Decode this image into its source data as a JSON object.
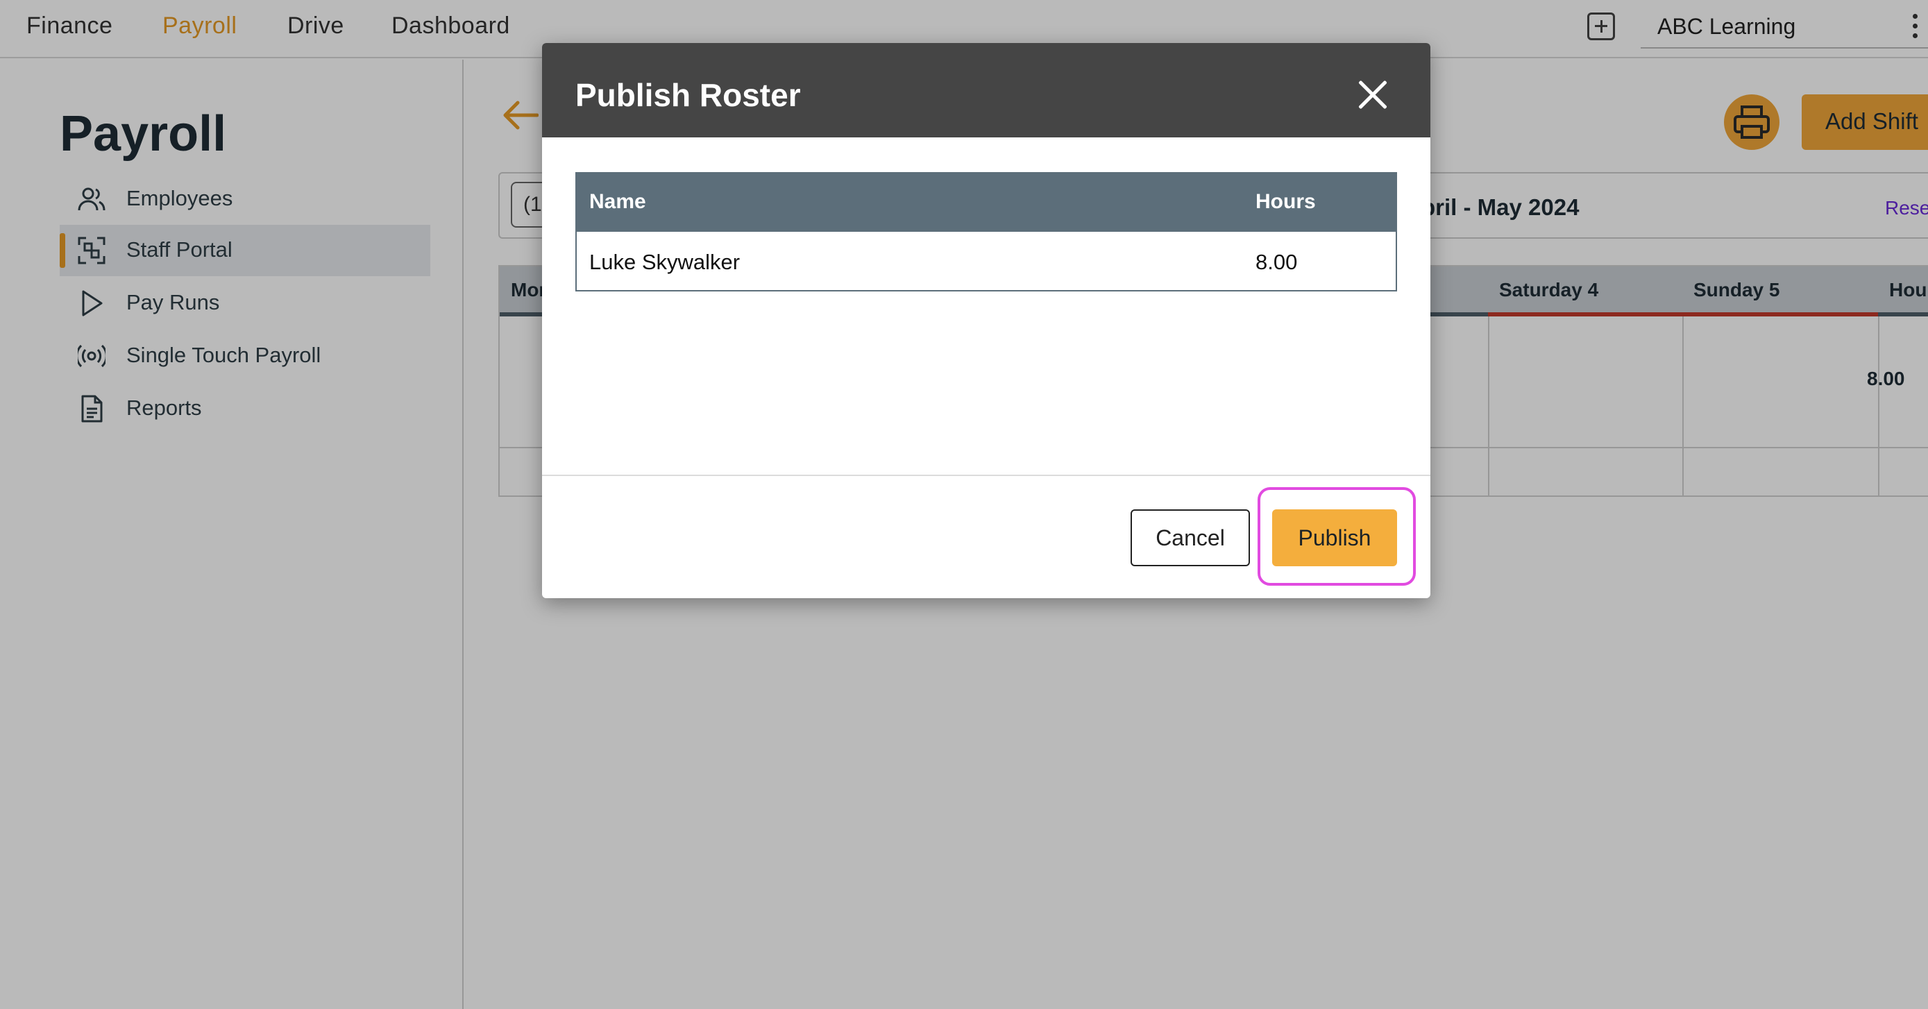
{
  "topnav": {
    "items": [
      {
        "label": "Finance",
        "active": false
      },
      {
        "label": "Payroll",
        "active": true
      },
      {
        "label": "Drive",
        "active": false
      },
      {
        "label": "Dashboard",
        "active": false
      }
    ],
    "organization": "ABC Learning"
  },
  "sidebar": {
    "title": "Payroll",
    "items": [
      {
        "label": "Employees",
        "icon": "people-icon",
        "active": false
      },
      {
        "label": "Staff Portal",
        "icon": "staff-portal-icon",
        "active": true
      },
      {
        "label": "Pay Runs",
        "icon": "play-icon",
        "active": false
      },
      {
        "label": "Single Touch Payroll",
        "icon": "broadcast-icon",
        "active": false
      },
      {
        "label": "Reports",
        "icon": "document-icon",
        "active": false
      }
    ]
  },
  "main": {
    "add_shift_label": "Add Shift",
    "date_input_value": "(1",
    "period_label": "pril - May 2024",
    "reset_label": "Rese",
    "grid": {
      "columns": [
        "Mon",
        "Saturday 4",
        "Sunday 5",
        "Hours"
      ],
      "hours_total": "8.00"
    }
  },
  "modal": {
    "title": "Publish Roster",
    "table": {
      "headers": {
        "name": "Name",
        "hours": "Hours"
      },
      "rows": [
        {
          "name": "Luke Skywalker",
          "hours": "8.00"
        }
      ]
    },
    "cancel_label": "Cancel",
    "publish_label": "Publish"
  },
  "colors": {
    "accent": "#f4ae3d",
    "modal_header": "#454545",
    "table_header": "#5c6e7a",
    "focus_ring": "#e14be0"
  }
}
